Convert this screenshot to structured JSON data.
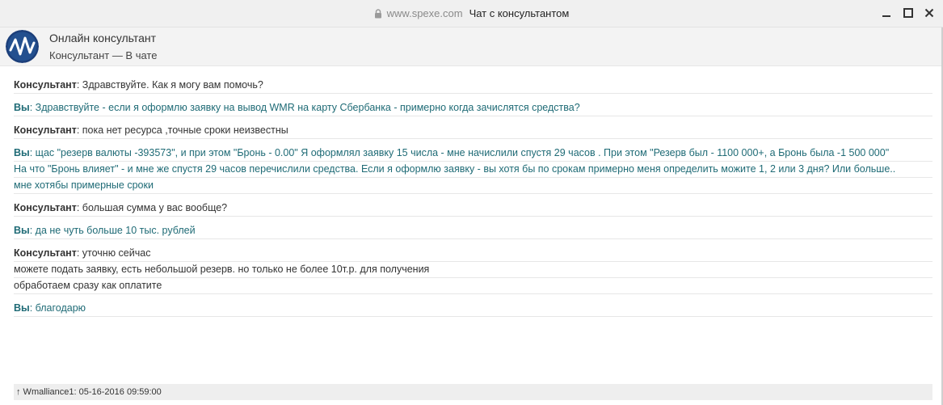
{
  "window": {
    "url": "www.spexe.com",
    "title": "Чат с консультантом"
  },
  "header": {
    "title": "Онлайн консультант",
    "status": "Консультант — В чате"
  },
  "messages": [
    {
      "role": "agent",
      "author": "Консультант",
      "lines": [
        "Здравствуйте. Как я могу вам помочь?"
      ]
    },
    {
      "role": "visitor",
      "author": "Вы",
      "lines": [
        "Здравствуйте - если я оформлю заявку на вывод WMR на карту Сбербанка - примерно когда зачислятся средства?"
      ]
    },
    {
      "role": "agent",
      "author": "Консультант",
      "lines": [
        "пока нет ресурса ,точные сроки неизвестны"
      ]
    },
    {
      "role": "visitor",
      "author": "Вы",
      "lines": [
        "щас \"резерв валюты -393573\", и при этом \"Бронь - 0.00\"  Я оформлял заявку 15 числа - мне начислили спустя 29 часов . При этом \"Резерв был - 1100 000+, а Бронь была -1 500 000\"",
        "На что \"Бронь влияет\" - и мне же спустя 29 часов перечислили средства. Если я оформлю заявку - вы хотя бы по срокам примерно меня определить можите 1, 2 или 3 дня? Или больше..",
        "мне хотябы примерные сроки"
      ]
    },
    {
      "role": "agent",
      "author": "Консультант",
      "lines": [
        "большая сумма у вас вообще?"
      ]
    },
    {
      "role": "visitor",
      "author": "Вы",
      "lines": [
        "да не чуть больше 10 тыс. рублей"
      ]
    },
    {
      "role": "agent",
      "author": "Консультант",
      "lines": [
        "уточню сейчас",
        "можете подать заявку, есть небольшой резерв. но только не более 10т.р. для получения",
        "обработаем сразу как оплатите"
      ]
    },
    {
      "role": "visitor",
      "author": "Вы",
      "lines": [
        "благодарю"
      ]
    }
  ],
  "footer": {
    "text": "↑ Wmalliance1: 05-16-2016 09:59:00"
  },
  "icons": {
    "lock": "lock-icon",
    "minimize": "minimize-icon",
    "maximize": "maximize-icon",
    "close": "close-icon",
    "avatar": "avatar-logo"
  },
  "colors": {
    "visitor_text": "#1f6b76",
    "agent_text": "#333333",
    "avatar_bg": "#1c3f7a"
  }
}
